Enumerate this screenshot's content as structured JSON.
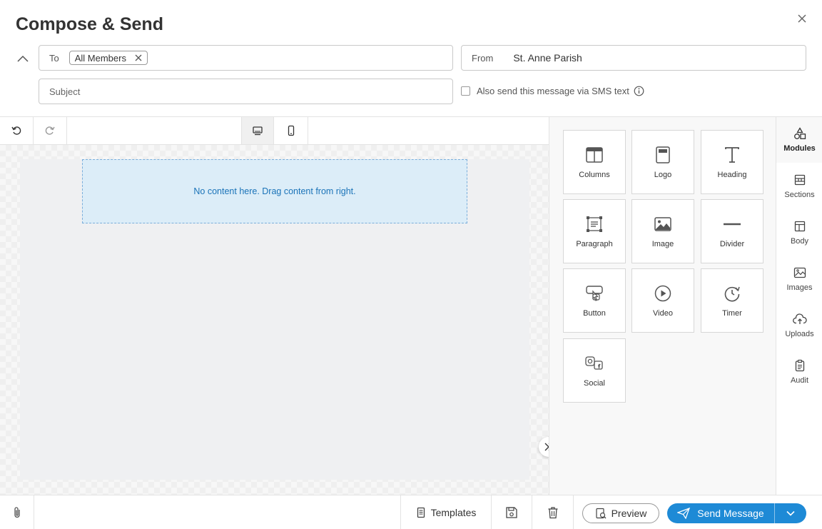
{
  "header": {
    "title": "Compose & Send",
    "to_label": "To",
    "to_chip": "All Members",
    "from_label": "From",
    "from_value": "St. Anne Parish",
    "subject_placeholder": "Subject",
    "sms_label": "Also send this message via SMS text"
  },
  "canvas": {
    "empty_text": "No content here. Drag content from right."
  },
  "modules": [
    {
      "label": "Columns",
      "icon": "columns-icon"
    },
    {
      "label": "Logo",
      "icon": "logo-icon"
    },
    {
      "label": "Heading",
      "icon": "heading-icon"
    },
    {
      "label": "Paragraph",
      "icon": "paragraph-icon"
    },
    {
      "label": "Image",
      "icon": "image-icon"
    },
    {
      "label": "Divider",
      "icon": "divider-icon"
    },
    {
      "label": "Button",
      "icon": "button-icon"
    },
    {
      "label": "Video",
      "icon": "video-icon"
    },
    {
      "label": "Timer",
      "icon": "timer-icon"
    },
    {
      "label": "Social",
      "icon": "social-icon"
    }
  ],
  "rail": [
    {
      "label": "Modules",
      "icon": "modules-icon"
    },
    {
      "label": "Sections",
      "icon": "sections-icon"
    },
    {
      "label": "Body",
      "icon": "body-icon"
    },
    {
      "label": "Images",
      "icon": "images-icon"
    },
    {
      "label": "Uploads",
      "icon": "uploads-icon"
    },
    {
      "label": "Audit",
      "icon": "audit-icon"
    }
  ],
  "footer": {
    "templates_label": "Templates",
    "preview_label": "Preview",
    "send_label": "Send Message"
  },
  "colors": {
    "accent": "#1e8ad6",
    "dropzone_bg": "#dcedf8",
    "dropzone_text": "#1a73b8"
  }
}
